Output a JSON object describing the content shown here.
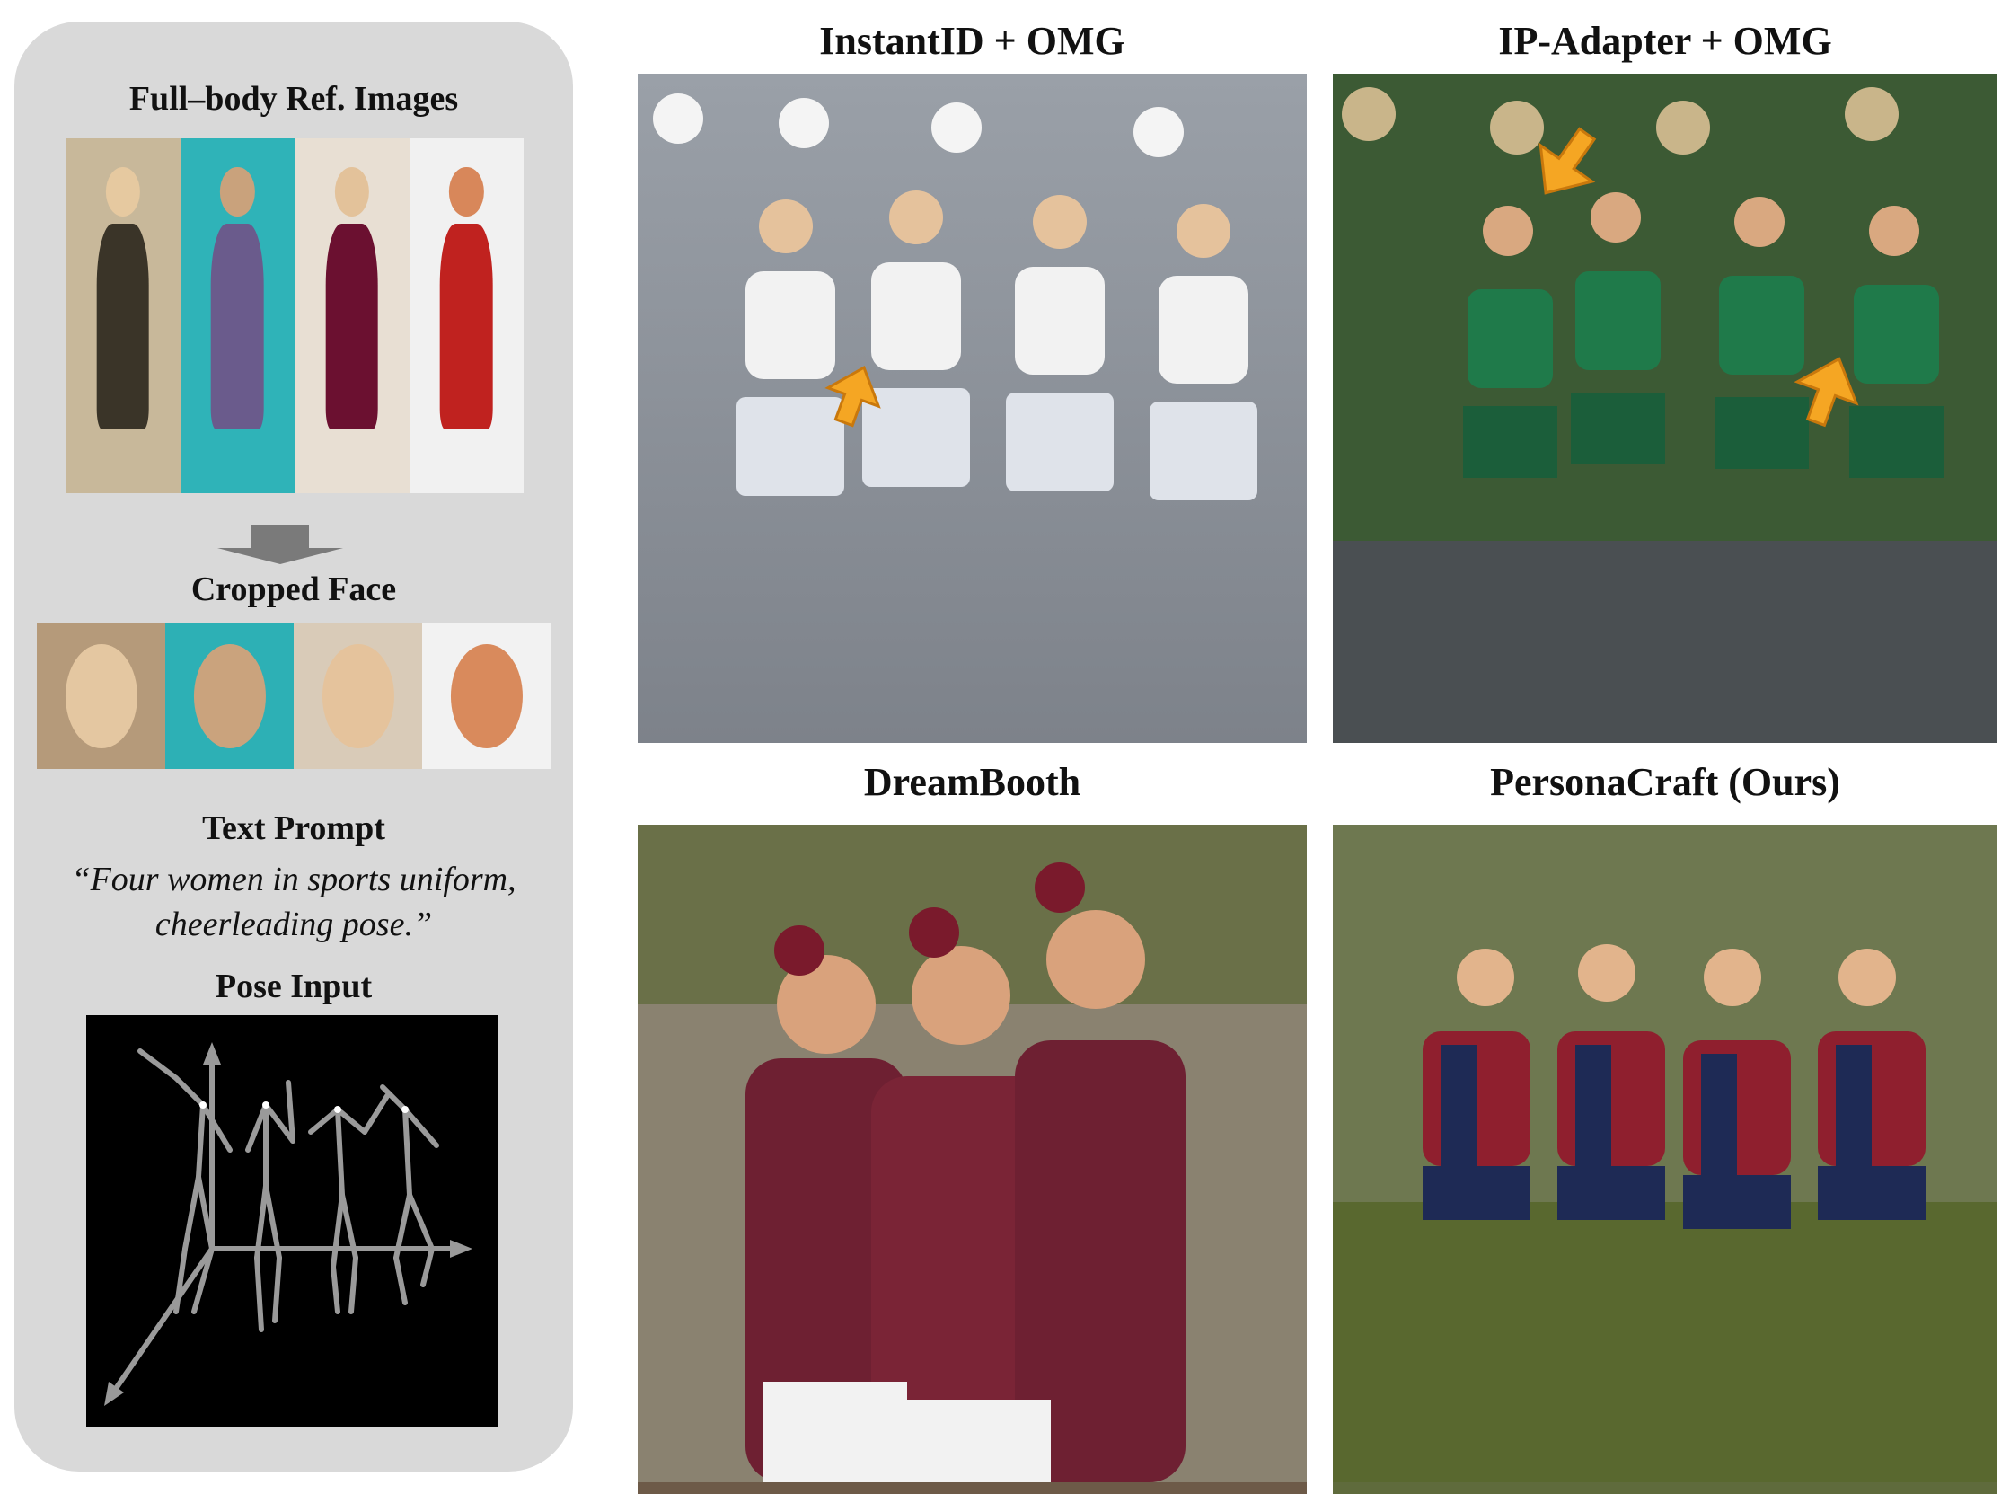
{
  "left_panel": {
    "ref_heading": "Full–body Ref. Images",
    "crop_heading": "Cropped Face",
    "prompt_heading": "Text Prompt",
    "prompt_line1": "“Four women in sports uniform,",
    "prompt_line2": "cheerleading pose.”",
    "pose_heading": "Pose Input"
  },
  "results": [
    {
      "title": "InstantID + OMG"
    },
    {
      "title": "IP-Adapter + OMG"
    },
    {
      "title": "DreamBooth"
    },
    {
      "title": "PersonaCraft (Ours)"
    }
  ],
  "colors": {
    "panel_bg": "#d9d9d9",
    "arrow": "#f5a623",
    "instantid_bg": "#8f939a",
    "ipadapter_bg": "#2f4a2c",
    "dreambooth_bg": "#6d5a48",
    "personacraft_bg": "#5f6b3c"
  }
}
